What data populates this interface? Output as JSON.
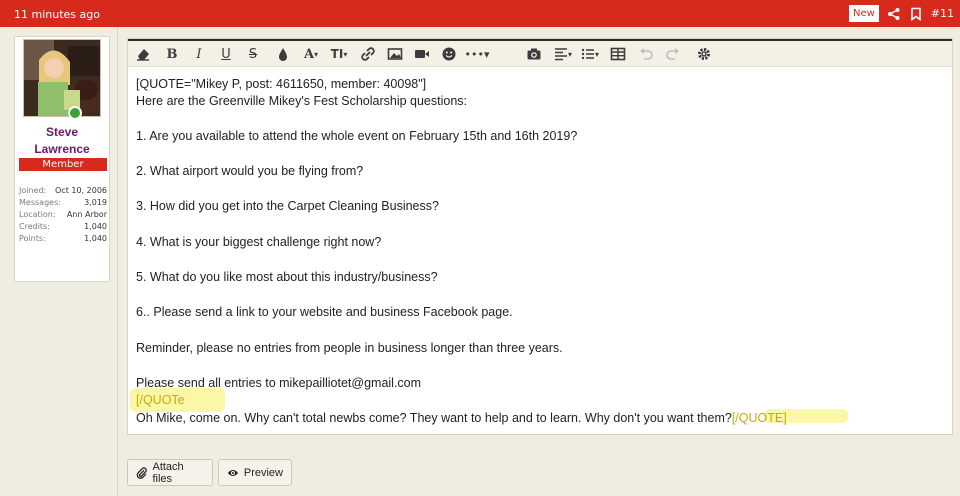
{
  "post": {
    "time": "11 minutes ago",
    "new_badge": "New",
    "post_number": "#11",
    "share_icon": "share-icon",
    "bookmark_icon": "bookmark-icon"
  },
  "user": {
    "name_line1": "Steve",
    "name_line2": "Lawrence",
    "role": "Member",
    "stats": [
      {
        "label": "Joined:",
        "value": "Oct 10, 2006"
      },
      {
        "label": "Messages:",
        "value": "3,019"
      },
      {
        "label": "Location:",
        "value": "Ann Arbor"
      },
      {
        "label": "Credits:",
        "value": "1,040"
      },
      {
        "label": "Points:",
        "value": "1,040"
      }
    ]
  },
  "toolbar": {
    "icons": [
      "eraser-icon",
      "bold-icon",
      "italic-icon",
      "underline-icon",
      "strikethrough-icon",
      "color-icon",
      "font-size-icon",
      "text-size-icon",
      "link-icon",
      "image-icon",
      "media-icon",
      "smilie-icon",
      "more-icon",
      "camera-icon",
      "align-icon",
      "list-icon",
      "table-icon",
      "undo-icon",
      "redo-icon",
      "settings-icon"
    ],
    "bold": "B",
    "italic": "I",
    "underline": "U",
    "strike": "S",
    "font": "A",
    "size": "TI"
  },
  "editor": {
    "lines": [
      "[QUOTE=\"Mikey P, post: 4611650, member: 40098\"]",
      "Here are the Greenville Mikey's Fest Scholarship questions:",
      "1. Are you available to attend the whole event on February 15th and 16th 2019?",
      "2. What airport would you be flying from?",
      "3. How did you get into the Carpet Cleaning Business?",
      "4. What is your biggest challenge right now?",
      "5. What do you like most about this industry/business?",
      "6.. Please send a link to your website and business Facebook page.",
      "Reminder, please no entries from people in business longer than three years.",
      "Please send all entries to mikepailliotet@gmail.com",
      "[/QUOTe",
      "Oh Mike, come on.  Why can't total newbs come?   They want to help and to learn.   Why don't you want them?",
      "[/QUOTE]"
    ]
  },
  "buttons": {
    "attach": "Attach files",
    "preview": "Preview"
  }
}
